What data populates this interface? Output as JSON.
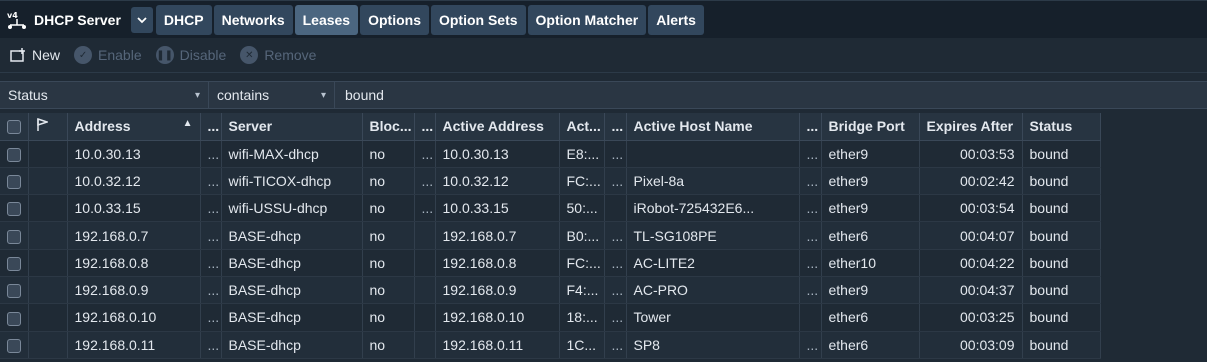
{
  "app": {
    "title": "DHCP Server"
  },
  "tabs": [
    {
      "label": "DHCP",
      "active": false
    },
    {
      "label": "Networks",
      "active": false
    },
    {
      "label": "Leases",
      "active": true
    },
    {
      "label": "Options",
      "active": false
    },
    {
      "label": "Option Sets",
      "active": false
    },
    {
      "label": "Option Matcher",
      "active": false
    },
    {
      "label": "Alerts",
      "active": false
    }
  ],
  "toolbar": {
    "new_label": "New",
    "enable_label": "Enable",
    "disable_label": "Disable",
    "remove_label": "Remove"
  },
  "filter": {
    "field": "Status",
    "operator": "contains",
    "value": "bound"
  },
  "table": {
    "columns": [
      "",
      "",
      "Address",
      "...",
      "Server",
      "Bloc...",
      "...",
      "Active Address",
      "Act...",
      "...",
      "Active Host Name",
      "...",
      "Bridge Port",
      "Expires After",
      "Status"
    ],
    "rows": [
      [
        "10.0.30.13",
        "...",
        "wifi-MAX-dhcp",
        "no",
        "...",
        "10.0.30.13",
        "E8:...",
        "...",
        "",
        "...",
        "ether9",
        "00:03:53",
        "bound"
      ],
      [
        "10.0.32.12",
        "...",
        "wifi-TICOX-dhcp",
        "no",
        "...",
        "10.0.32.12",
        "FC:...",
        "...",
        "Pixel-8a",
        "...",
        "ether9",
        "00:02:42",
        "bound"
      ],
      [
        "10.0.33.15",
        "...",
        "wifi-USSU-dhcp",
        "no",
        "...",
        "10.0.33.15",
        "50:...",
        "",
        "iRobot-725432E6...",
        "...",
        "ether9",
        "00:03:54",
        "bound"
      ],
      [
        "192.168.0.7",
        "...",
        "BASE-dhcp",
        "no",
        "",
        "192.168.0.7",
        "B0:...",
        "...",
        "TL-SG108PE",
        "...",
        "ether6",
        "00:04:07",
        "bound"
      ],
      [
        "192.168.0.8",
        "...",
        "BASE-dhcp",
        "no",
        "",
        "192.168.0.8",
        "FC:...",
        "...",
        "AC-LITE2",
        "...",
        "ether10",
        "00:04:22",
        "bound"
      ],
      [
        "192.168.0.9",
        "...",
        "BASE-dhcp",
        "no",
        "",
        "192.168.0.9",
        "F4:...",
        "...",
        "AC-PRO",
        "...",
        "ether9",
        "00:04:37",
        "bound"
      ],
      [
        "192.168.0.10",
        "...",
        "BASE-dhcp",
        "no",
        "",
        "192.168.0.10",
        "18:...",
        "...",
        "Tower",
        "",
        "ether6",
        "00:03:25",
        "bound"
      ],
      [
        "192.168.0.11",
        "...",
        "BASE-dhcp",
        "no",
        "",
        "192.168.0.11",
        "1C...",
        "...",
        "SP8",
        "...",
        "ether6",
        "00:03:09",
        "bound"
      ]
    ]
  }
}
